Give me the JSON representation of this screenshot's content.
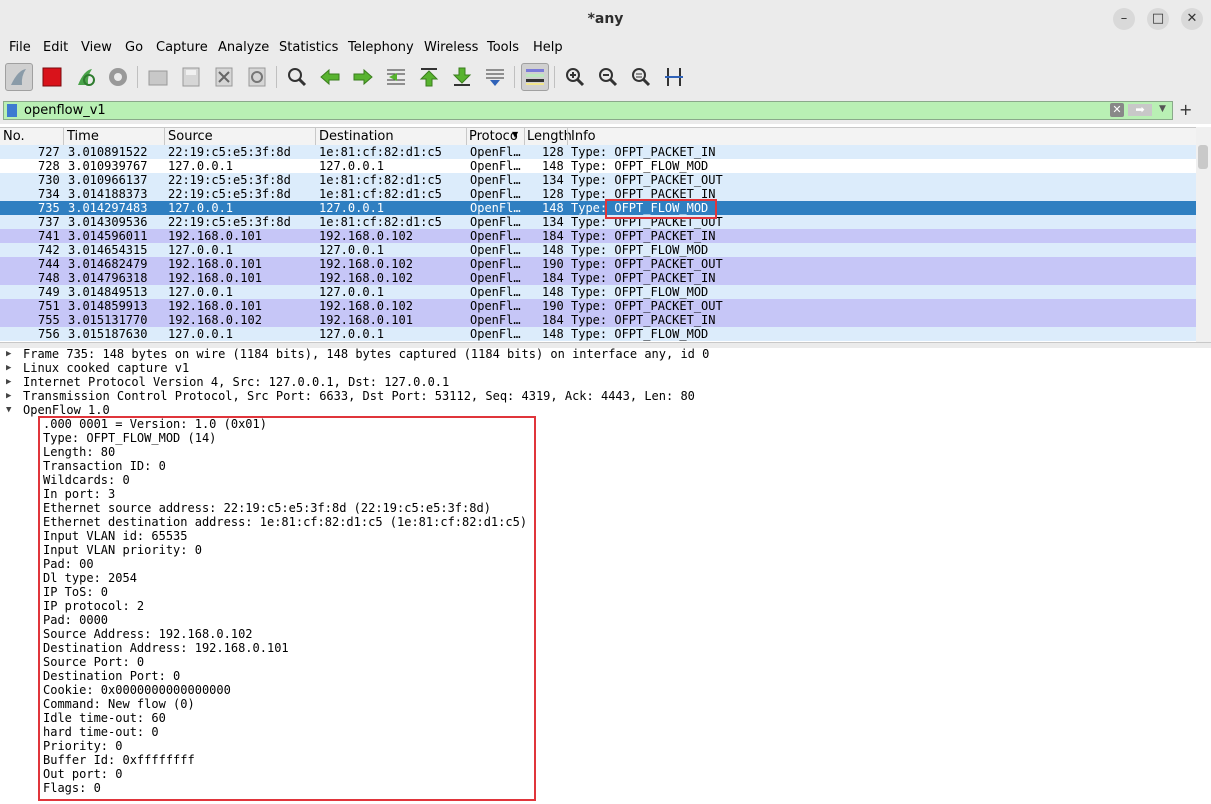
{
  "window": {
    "title": "*any",
    "minimize_icon": "–",
    "maximize_icon": "□",
    "close_icon": "✕"
  },
  "menu": [
    "File",
    "Edit",
    "View",
    "Go",
    "Capture",
    "Analyze",
    "Statistics",
    "Telephony",
    "Wireless",
    "Tools",
    "Help"
  ],
  "toolbar": {
    "icons": [
      "shark-fin-start-icon",
      "stop-capture-icon",
      "restart-capture-icon",
      "capture-options-icon",
      "open-file-icon",
      "save-file-icon",
      "close-file-icon",
      "reload-file-icon",
      "find-packet-icon",
      "go-back-icon",
      "go-forward-icon",
      "go-to-packet-icon",
      "go-first-icon",
      "go-last-icon",
      "autoscroll-icon",
      "colorize-icon",
      "zoom-in-icon",
      "zoom-out-icon",
      "zoom-normal-icon",
      "resize-columns-icon"
    ]
  },
  "filter": {
    "value": "openflow_v1",
    "plus_label": "+"
  },
  "columns": {
    "no": "No.",
    "time": "Time",
    "source": "Source",
    "destination": "Destination",
    "protocol": "Protoco",
    "length": "Length",
    "info": "Info"
  },
  "packets": [
    {
      "no": "727",
      "time": "3.010891522",
      "src": "22:19:c5:e5:3f:8d",
      "dst": "1e:81:cf:82:d1:c5",
      "proto": "OpenFl…",
      "len": "128",
      "info": "Type: OFPT_PACKET_IN"
    },
    {
      "no": "728",
      "time": "3.010939767",
      "src": "127.0.0.1",
      "dst": "127.0.0.1",
      "proto": "OpenFl…",
      "len": "148",
      "info": "Type: OFPT_FLOW_MOD"
    },
    {
      "no": "730",
      "time": "3.010966137",
      "src": "22:19:c5:e5:3f:8d",
      "dst": "1e:81:cf:82:d1:c5",
      "proto": "OpenFl…",
      "len": "134",
      "info": "Type: OFPT_PACKET_OUT"
    },
    {
      "no": "734",
      "time": "3.014188373",
      "src": "22:19:c5:e5:3f:8d",
      "dst": "1e:81:cf:82:d1:c5",
      "proto": "OpenFl…",
      "len": "128",
      "info": "Type: OFPT_PACKET_IN"
    },
    {
      "no": "735",
      "time": "3.014297483",
      "src": "127.0.0.1",
      "dst": "127.0.0.1",
      "proto": "OpenFl…",
      "len": "148",
      "info": "Type: OFPT_FLOW_MOD"
    },
    {
      "no": "737",
      "time": "3.014309536",
      "src": "22:19:c5:e5:3f:8d",
      "dst": "1e:81:cf:82:d1:c5",
      "proto": "OpenFl…",
      "len": "134",
      "info": "Type: OFPT_PACKET_OUT"
    },
    {
      "no": "741",
      "time": "3.014596011",
      "src": "192.168.0.101",
      "dst": "192.168.0.102",
      "proto": "OpenFl…",
      "len": "184",
      "info": "Type: OFPT_PACKET_IN"
    },
    {
      "no": "742",
      "time": "3.014654315",
      "src": "127.0.0.1",
      "dst": "127.0.0.1",
      "proto": "OpenFl…",
      "len": "148",
      "info": "Type: OFPT_FLOW_MOD"
    },
    {
      "no": "744",
      "time": "3.014682479",
      "src": "192.168.0.101",
      "dst": "192.168.0.102",
      "proto": "OpenFl…",
      "len": "190",
      "info": "Type: OFPT_PACKET_OUT"
    },
    {
      "no": "748",
      "time": "3.014796318",
      "src": "192.168.0.101",
      "dst": "192.168.0.102",
      "proto": "OpenFl…",
      "len": "184",
      "info": "Type: OFPT_PACKET_IN"
    },
    {
      "no": "749",
      "time": "3.014849513",
      "src": "127.0.0.1",
      "dst": "127.0.0.1",
      "proto": "OpenFl…",
      "len": "148",
      "info": "Type: OFPT_FLOW_MOD"
    },
    {
      "no": "751",
      "time": "3.014859913",
      "src": "192.168.0.101",
      "dst": "192.168.0.102",
      "proto": "OpenFl…",
      "len": "190",
      "info": "Type: OFPT_PACKET_OUT"
    },
    {
      "no": "755",
      "time": "3.015131770",
      "src": "192.168.0.102",
      "dst": "192.168.0.101",
      "proto": "OpenFl…",
      "len": "184",
      "info": "Type: OFPT_PACKET_IN"
    },
    {
      "no": "756",
      "time": "3.015187630",
      "src": "127.0.0.1",
      "dst": "127.0.0.1",
      "proto": "OpenFl…",
      "len": "148",
      "info": "Type: OFPT_FLOW_MOD"
    }
  ],
  "row_colors": {
    "selected": "#2f7fc1",
    "light_blue": "#dcecfb",
    "lavender": "#c6c6f7",
    "white": "#ffffff",
    "highlight_box": "#e0353b"
  },
  "details": {
    "tree": [
      "Frame 735: 148 bytes on wire (1184 bits), 148 bytes captured (1184 bits) on interface any, id 0",
      "Linux cooked capture v1",
      "Internet Protocol Version 4, Src: 127.0.0.1, Dst: 127.0.0.1",
      "Transmission Control Protocol, Src Port: 6633, Dst Port: 53112, Seq: 4319, Ack: 4443, Len: 80",
      "OpenFlow 1.0"
    ],
    "openflow": [
      ".000 0001 = Version: 1.0 (0x01)",
      "Type: OFPT_FLOW_MOD (14)",
      "Length: 80",
      "Transaction ID: 0",
      "Wildcards: 0",
      "In port: 3",
      "Ethernet source address: 22:19:c5:e5:3f:8d (22:19:c5:e5:3f:8d)",
      "Ethernet destination address: 1e:81:cf:82:d1:c5 (1e:81:cf:82:d1:c5)",
      "Input VLAN id: 65535",
      "Input VLAN priority: 0",
      "Pad: 00",
      "Dl type: 2054",
      "IP ToS: 0",
      "IP protocol: 2",
      "Pad: 0000",
      "Source Address: 192.168.0.102",
      "Destination Address: 192.168.0.101",
      "Source Port: 0",
      "Destination Port: 0",
      "Cookie: 0x0000000000000000",
      "Command: New flow (0)",
      "Idle time-out: 60",
      "hard time-out: 0",
      "Priority: 0",
      "Buffer Id: 0xffffffff",
      "Out port: 0",
      "Flags: 0"
    ]
  }
}
